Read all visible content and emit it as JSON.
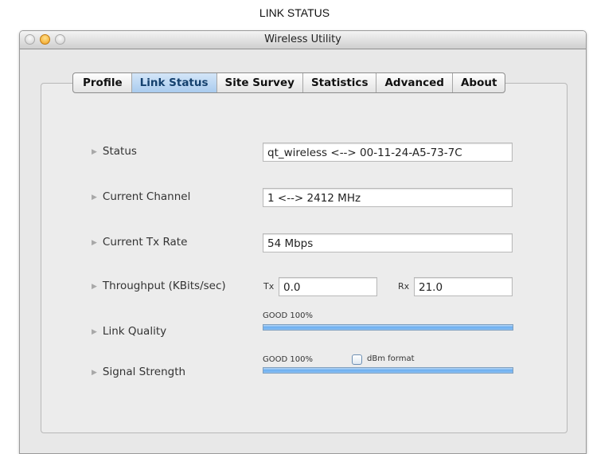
{
  "caption": "LINK STATUS",
  "window": {
    "title": "Wireless Utility"
  },
  "tabs": [
    {
      "label": "Profile",
      "active": false
    },
    {
      "label": "Link Status",
      "active": true
    },
    {
      "label": "Site Survey",
      "active": false
    },
    {
      "label": "Statistics",
      "active": false
    },
    {
      "label": "Advanced",
      "active": false
    },
    {
      "label": "About",
      "active": false
    }
  ],
  "status": {
    "label": "Status",
    "value": "qt_wireless <--> 00-11-24-A5-73-7C"
  },
  "channel": {
    "label": "Current Channel",
    "value": "1 <--> 2412 MHz"
  },
  "tx_rate": {
    "label": "Current Tx Rate",
    "value": "54 Mbps"
  },
  "throughput": {
    "label": "Throughput (KBits/sec)",
    "tx_label": "Tx",
    "tx_value": "0.0",
    "rx_label": "Rx",
    "rx_value": "21.0"
  },
  "link_quality": {
    "label": "Link Quality",
    "caption": "GOOD 100%",
    "percent": 100
  },
  "signal_strength": {
    "label": "Signal Strength",
    "caption": "GOOD 100%",
    "percent": 100,
    "dbm_label": "dBm format",
    "dbm_checked": false
  },
  "colors": {
    "active_tab": "#a9cbee",
    "bar_fill": "#6aaef0",
    "minimize_button": "#f0a020"
  }
}
